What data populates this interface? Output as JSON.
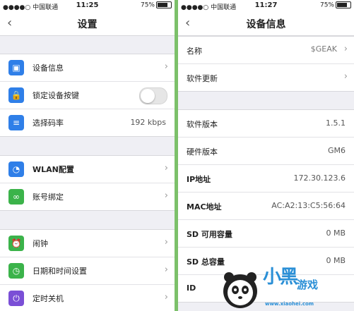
{
  "left": {
    "status": {
      "carrier": "●●●●○ 中国联通",
      "time": "11:25",
      "battery": "75%"
    },
    "title": "设置",
    "group1": [
      {
        "label": "设备信息",
        "icon": "device-info-icon",
        "color": "#2f7fe8"
      },
      {
        "label": "锁定设备按键",
        "icon": "lock-icon",
        "color": "#2f7fe8"
      },
      {
        "label": "选择码率",
        "value": "192 kbps",
        "icon": "bitrate-icon",
        "color": "#2f7fe8"
      }
    ],
    "group2": [
      {
        "label": "WLAN配置",
        "icon": "wifi-icon",
        "color": "#2f7fe8"
      },
      {
        "label": "账号绑定",
        "icon": "link-icon",
        "color": "#3bb34a"
      }
    ],
    "group3": [
      {
        "label": "闹钟",
        "icon": "alarm-icon",
        "color": "#3bb34a"
      },
      {
        "label": "日期和时间设置",
        "icon": "clock-icon",
        "color": "#3bb34a"
      },
      {
        "label": "定时关机",
        "icon": "timer-power-icon",
        "color": "#7a4fd6"
      }
    ]
  },
  "right": {
    "status": {
      "carrier": "●●●●○ 中国联通",
      "time": "11:27",
      "battery": "75%"
    },
    "title": "设备信息",
    "group1": [
      {
        "label": "名称",
        "value": "$GEAK"
      },
      {
        "label": "软件更新",
        "value": ""
      }
    ],
    "group2": [
      {
        "label": "软件版本",
        "value": "1.5.1"
      },
      {
        "label": "硬件版本",
        "value": "GM6"
      },
      {
        "label": "IP地址",
        "value": "172.30.123.6"
      },
      {
        "label": "MAC地址",
        "value": "AC:A2:13:C5:56:64"
      },
      {
        "label": "SD 可用容量",
        "value": "0 MB"
      },
      {
        "label": "SD 总容量",
        "value": "0 MB"
      },
      {
        "label": "ID",
        "value": ""
      }
    ]
  },
  "watermark": {
    "big": "小黑",
    "small": "游戏",
    "url": "www.xiaohei.com"
  }
}
